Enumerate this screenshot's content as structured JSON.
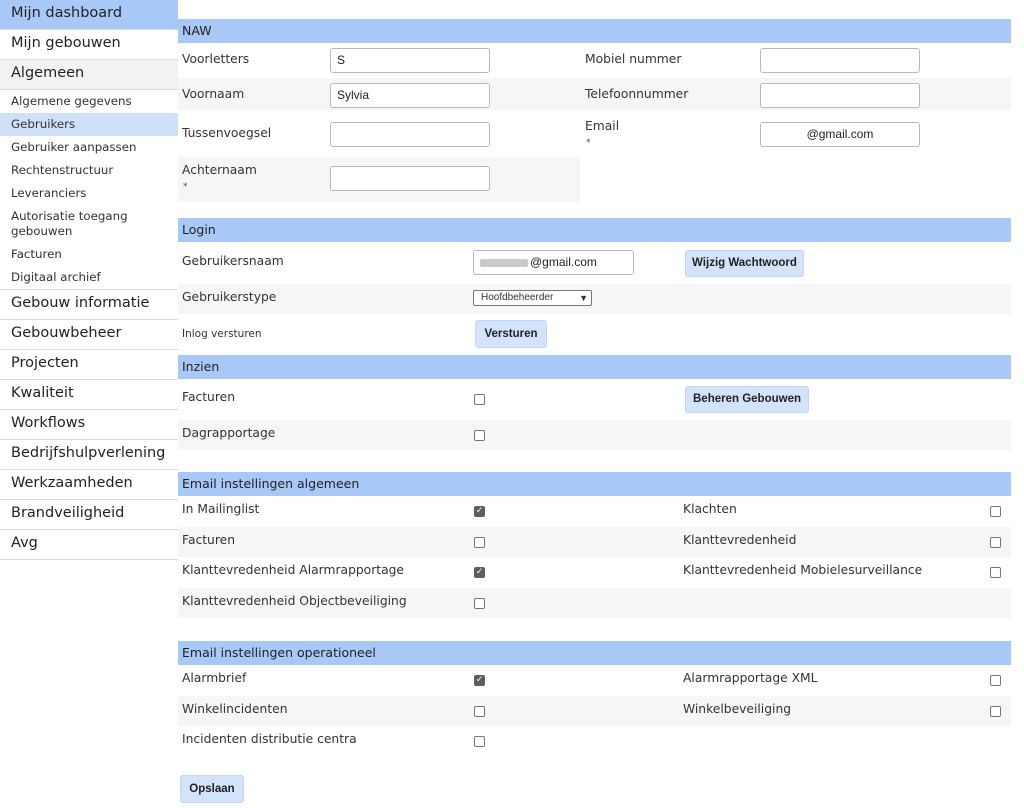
{
  "sidebar": {
    "items": [
      {
        "label": "Mijn dashboard",
        "name": "sidebar-item-mijn-dashboard",
        "style": "active"
      },
      {
        "label": "Mijn gebouwen",
        "name": "sidebar-item-mijn-gebouwen",
        "style": ""
      },
      {
        "label": "Algemeen",
        "name": "sidebar-item-algemeen",
        "style": "group"
      }
    ],
    "subitems": [
      {
        "label": "Algemene gegevens",
        "name": "sidebar-subitem-algemene-gegevens",
        "active": false
      },
      {
        "label": "Gebruikers",
        "name": "sidebar-subitem-gebruikers",
        "active": true
      },
      {
        "label": "Gebruiker aanpassen",
        "name": "sidebar-subitem-gebruiker-aanpassen",
        "active": false
      },
      {
        "label": "Rechtenstructuur",
        "name": "sidebar-subitem-rechtenstructuur",
        "active": false
      },
      {
        "label": "Leveranciers",
        "name": "sidebar-subitem-leveranciers",
        "active": false
      },
      {
        "label": "Autorisatie toegang gebouwen",
        "name": "sidebar-subitem-autorisatie-toegang-gebouwen",
        "active": false
      },
      {
        "label": "Facturen",
        "name": "sidebar-subitem-facturen",
        "active": false
      },
      {
        "label": "Digitaal archief",
        "name": "sidebar-subitem-digitaal-archief",
        "active": false
      }
    ],
    "bottom_items": [
      {
        "label": "Gebouw informatie",
        "name": "sidebar-item-gebouw-informatie"
      },
      {
        "label": "Gebouwbeheer",
        "name": "sidebar-item-gebouwbeheer"
      },
      {
        "label": "Projecten",
        "name": "sidebar-item-projecten"
      },
      {
        "label": "Kwaliteit",
        "name": "sidebar-item-kwaliteit"
      },
      {
        "label": "Workflows",
        "name": "sidebar-item-workflows"
      },
      {
        "label": "Bedrijfshulpverlening",
        "name": "sidebar-item-bedrijfshulpverlening"
      },
      {
        "label": "Werkzaamheden",
        "name": "sidebar-item-werkzaamheden"
      },
      {
        "label": "Brandveiligheid",
        "name": "sidebar-item-brandveiligheid"
      },
      {
        "label": "Avg",
        "name": "sidebar-item-avg"
      }
    ]
  },
  "naw": {
    "title": "NAW",
    "voorletters_label": "Voorletters",
    "voorletters_value": "S",
    "voornaam_label": "Voornaam",
    "voornaam_value": "Sylvia",
    "tussenvoegsel_label": "Tussenvoegsel",
    "tussenvoegsel_value": "",
    "achternaam_label": "Achternaam",
    "achternaam_value": "",
    "mobiel_label": "Mobiel nummer",
    "mobiel_value": "",
    "telefoon_label": "Telefoonnummer",
    "telefoon_value": "",
    "email_label": "Email",
    "email_value": "@gmail.com",
    "required_marker": "*"
  },
  "login": {
    "title": "Login",
    "gebruikersnaam_label": "Gebruikersnaam",
    "gebruikersnaam_value": "@gmail.com",
    "wijzig_button": "Wijzig Wachtwoord",
    "gebruikerstype_label": "Gebruikerstype",
    "gebruikerstype_value": "Hoofdbeheerder",
    "inlog_label": "Inlog versturen",
    "versturen_button": "Versturen"
  },
  "inzien": {
    "title": "Inzien",
    "facturen_label": "Facturen",
    "facturen_checked": false,
    "dagrapportage_label": "Dagrapportage",
    "dagrapportage_checked": false,
    "beheren_button": "Beheren Gebouwen"
  },
  "email_algemeen": {
    "title": "Email instellingen algemeen",
    "left": [
      {
        "label": "In Mailinglist",
        "checked": true
      },
      {
        "label": "Facturen",
        "checked": false
      },
      {
        "label": "Klanttevredenheid Alarmrapportage",
        "checked": true
      },
      {
        "label": "Klanttevredenheid Objectbeveiliging",
        "checked": false
      }
    ],
    "right": [
      {
        "label": "Klachten",
        "checked": false
      },
      {
        "label": "Klanttevredenheid",
        "checked": false
      },
      {
        "label": "Klanttevredenheid Mobielesurveillance",
        "checked": false
      }
    ]
  },
  "email_operationeel": {
    "title": "Email instellingen operationeel",
    "left": [
      {
        "label": "Alarmbrief",
        "checked": true
      },
      {
        "label": "Winkelincidenten",
        "checked": false
      },
      {
        "label": "Incidenten distributie centra",
        "checked": false
      }
    ],
    "right": [
      {
        "label": "Alarmrapportage XML",
        "checked": false
      },
      {
        "label": "Winkelbeveiliging",
        "checked": false
      }
    ]
  },
  "footer": {
    "opslaan_button": "Opslaan"
  },
  "colors": {
    "section_header_bg": "#a8c8f8",
    "sidebar_active_bg": "#a8c8f8",
    "button_bg": "#d3e3fb",
    "stripe_bg": "#f6f6f6"
  },
  "icons": {
    "checkbox_checked": "check-icon",
    "select_caret": "chevron-down-icon"
  }
}
